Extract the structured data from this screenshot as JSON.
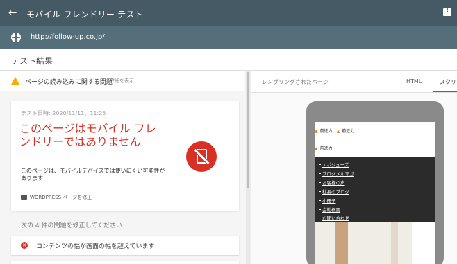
{
  "topbar": {
    "back_glyph": "←",
    "title": "モバイル フレンドリー テスト",
    "feedback_icon": "feedback-icon"
  },
  "urlbar": {
    "url": "http://follow-up.co.jp/"
  },
  "results": {
    "title": "テスト結果"
  },
  "issues_bar": {
    "label": "ページの読み込みに関する問題",
    "detail_link": "詳細を表示"
  },
  "result_card": {
    "date": "テスト日時: 2020/11/11、11:25",
    "headline": "このページはモバイル フレンドリーではありません",
    "description": "このページは、モバイルデバイスでは使いにくい可能性があります",
    "fix_link": "WORDPRESS ページを修正"
  },
  "fix_section": {
    "heading": "次の 4 件の問題を修正してください",
    "issues": [
      {
        "label": "コンテンツの幅が画面の幅を超えています"
      }
    ]
  },
  "preview": {
    "rendered_label": "レンダリングされたページ",
    "tabs": [
      {
        "label": "HTML"
      },
      {
        "label": "スクリ"
      }
    ]
  },
  "phone_screen": {
    "logo_text": "前進力",
    "menu_items": [
      "エポジューズ",
      "ブログメルマガ",
      "お客様の声",
      "社長のブログ",
      "小冊子",
      "会社概要",
      "お問い合わせ"
    ]
  },
  "colors": {
    "topbar": "#455a64",
    "urlbar": "#546e7a",
    "error_red": "#d93025",
    "warning": "#f9ab00",
    "accent": "#1a73e8"
  }
}
